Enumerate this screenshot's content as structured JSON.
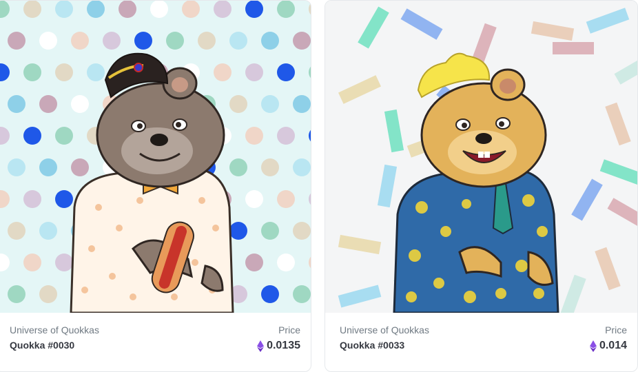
{
  "cards": [
    {
      "collection": "Universe of Quokkas",
      "name": "Quokka #0030",
      "price_label": "Price",
      "price": "0.0135",
      "currency_icon": "ethereum-icon",
      "background": "#e4f6f6"
    },
    {
      "collection": "Universe of Quokkas",
      "name": "Quokka #0033",
      "price_label": "Price",
      "price": "0.014",
      "currency_icon": "ethereum-icon",
      "background": "#f4f5f6"
    }
  ],
  "colors": {
    "text_primary": "#353840",
    "text_secondary": "#707a83",
    "eth_purple": "#8a4fe6"
  }
}
